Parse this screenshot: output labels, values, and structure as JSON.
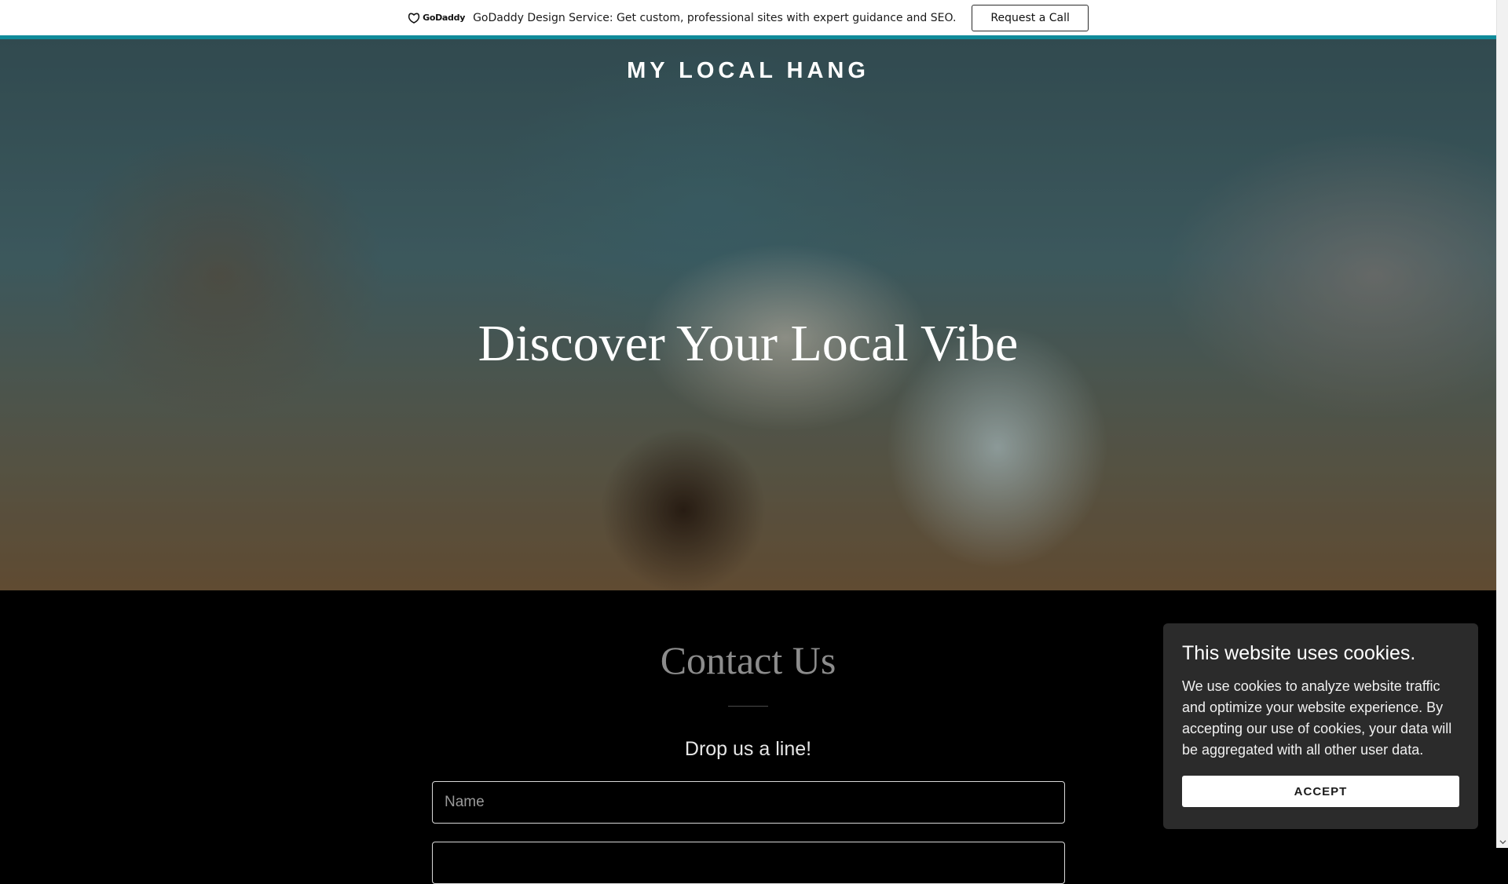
{
  "promo": {
    "logo_text": "GoDaddy",
    "message": "GoDaddy Design Service: Get custom, professional sites with expert guidance and SEO.",
    "button_label": "Request a Call"
  },
  "hero": {
    "site_title": "MY LOCAL HANG",
    "heading": "Discover Your Local Vibe"
  },
  "contact": {
    "title": "Contact Us",
    "subtitle": "Drop us a line!",
    "name_placeholder": "Name",
    "second_placeholder": ""
  },
  "cookie": {
    "title": "This website uses cookies.",
    "text": "We use cookies to analyze website traffic and optimize your website experience. By accepting our use of cookies, your data will be aggregated with all other user data.",
    "button_label": "ACCEPT"
  },
  "colors": {
    "accent": "#0f8b9a",
    "cookie_bg": "#2b2b2b",
    "contact_title": "#8c8c8c"
  }
}
